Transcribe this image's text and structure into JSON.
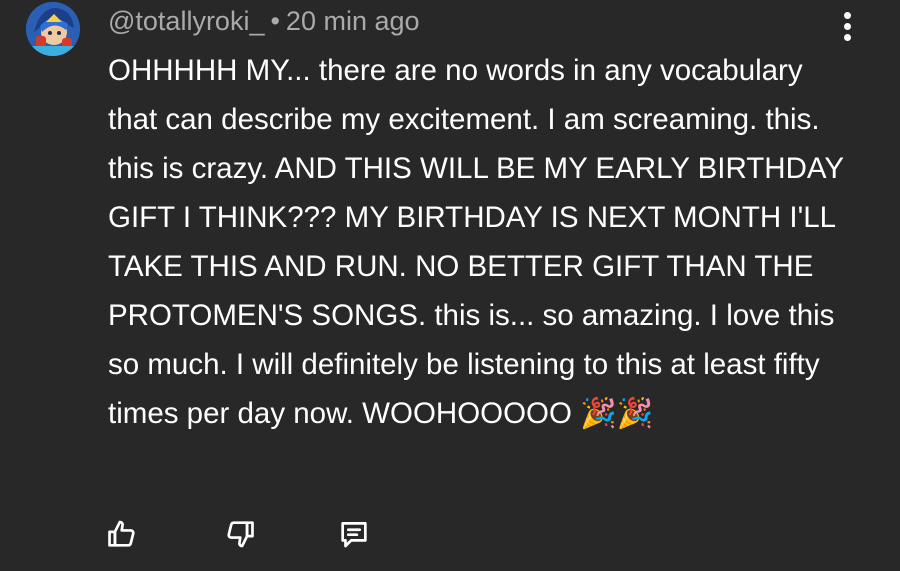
{
  "comment": {
    "author": "@totallyroki_",
    "separator": "•",
    "timestamp": "20 min ago",
    "text": "OHHHHH MY... there are no words in any vocabulary that can describe my excitement. I am screaming. this. this is crazy. AND THIS WILL BE MY EARLY BIRTHDAY GIFT I THINK??? MY BIRTHDAY IS NEXT MONTH I'LL TAKE THIS AND RUN. NO BETTER GIFT THAN THE PROTOMEN'S SONGS. this is... so amazing. I love this so much. I will definitely be listening to this at least fifty times per day now. WOOHOOOOO 🎉🎉"
  },
  "icons": {
    "avatar": "avatar-icon",
    "more": "more-vert-icon",
    "like": "thumbs-up-icon",
    "dislike": "thumbs-down-icon",
    "reply": "reply-comment-icon"
  },
  "colors": {
    "background": "#282828",
    "text": "#ffffff",
    "meta_text": "#aaaaaa"
  }
}
